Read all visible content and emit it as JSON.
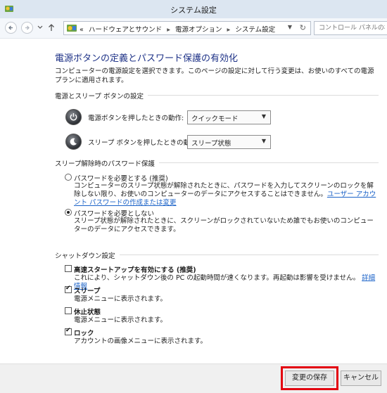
{
  "window": {
    "title": "システム設定",
    "app_icon": "control-panel-icon"
  },
  "nav": {
    "breadcrumbs": [
      "ハードウェアとサウンド",
      "電源オプション",
      "システム設定"
    ],
    "prefix": "«",
    "search_placeholder": "コントロール パネルの検索"
  },
  "page": {
    "title": "電源ボタンの定義とパスワード保護の有効化",
    "intro": "コンピューターの電源設定を選択できます。このページの設定に対して行う変更は、お使いのすべての電源プランに適用されます。"
  },
  "power_settings": {
    "group_label": "電源とスリープ ボタンの設定",
    "power_button_label": "電源ボタンを押したときの動作:",
    "power_button_value": "クイックモード",
    "sleep_button_label": "スリープ ボタンを押したときの動作:",
    "sleep_button_value": "スリープ状態"
  },
  "password": {
    "group_label": "スリープ解除時のパスワード保護",
    "require_label": "パスワードを必要とする (推奨)",
    "require_desc": "コンピューターのスリープ状態が解除されたときに、パスワードを入力してスクリーンのロックを解除しない限り、お使いのコンピューターのデータにアクセスすることはできません。",
    "require_link": "ユーザー アカウント パスワードの作成または変更",
    "no_require_label": "パスワードを必要としない",
    "no_require_desc": "スリープ状態が解除されたときに、スクリーンがロックされていないため誰でもお使いのコンピューターのデータにアクセスできます。",
    "selected": "no_require"
  },
  "shutdown": {
    "group_label": "シャットダウン設定",
    "items": [
      {
        "label": "高速スタートアップを有効にする (推奨)",
        "desc": "これにより、シャットダウン後の PC の起動時間が速くなります。再起動は影響を受けません。",
        "link": "詳細情報",
        "checked": false
      },
      {
        "label": "スリープ",
        "desc": "電源メニューに表示されます。",
        "checked": true
      },
      {
        "label": "休止状態",
        "desc": "電源メニューに表示されます。",
        "checked": false
      },
      {
        "label": "ロック",
        "desc": "アカウントの画像メニューに表示されます。",
        "checked": true
      }
    ]
  },
  "footer": {
    "save_label": "変更の保存",
    "cancel_label": "キャンセル",
    "highlight_color": "#e3000f"
  }
}
